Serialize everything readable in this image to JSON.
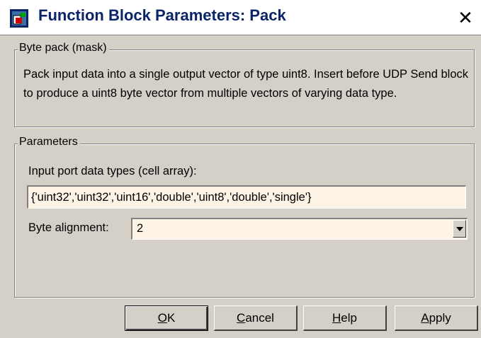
{
  "window": {
    "title": "Function Block Parameters: Pack",
    "close_glyph": "✕"
  },
  "mask_group": {
    "legend": "Byte pack (mask)",
    "description": "Pack input data into a single output vector of type uint8. Insert before UDP Send block to produce a uint8 byte vector from multiple vectors of varying data type."
  },
  "params_group": {
    "legend": "Parameters",
    "input_types_label": "Input port data types (cell array):",
    "input_types_value": "{'uint32','uint32','uint16','double','uint8','double','single'}",
    "byte_alignment_label": "Byte alignment:",
    "byte_alignment_value": "2"
  },
  "buttons": {
    "ok": {
      "mnemonic": "O",
      "rest": "K"
    },
    "cancel": {
      "mnemonic": "C",
      "rest": "ancel"
    },
    "help": {
      "mnemonic": "H",
      "rest": "elp"
    },
    "apply": {
      "mnemonic": "A",
      "rest": "pply"
    }
  },
  "colors": {
    "title_text": "#0a246a",
    "dialog_bg": "#d4d0c8",
    "field_bg": "#fdf4e6"
  },
  "icons": {
    "app": "simulink-block-icon",
    "close": "close-icon",
    "dropdown": "chevron-down-icon"
  }
}
